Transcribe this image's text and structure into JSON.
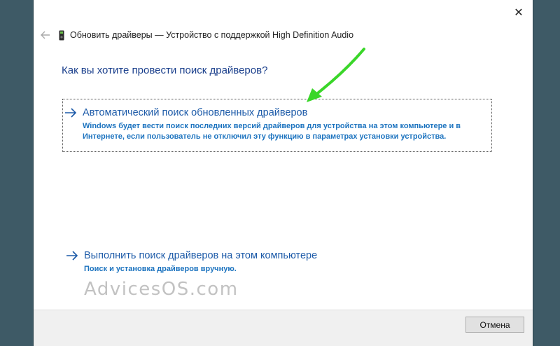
{
  "window": {
    "title": "Обновить драйверы — Устройство с поддержкой High Definition Audio"
  },
  "question": "Как вы хотите провести поиск драйверов?",
  "options": [
    {
      "title": "Автоматический поиск обновленных драйверов",
      "description_line1": "Windows будет вести поиск последних версий драйверов для устройства на этом компьютере и в",
      "description_line2": "Интернете, если пользователь не отключил эту функцию в параметрах установки устройства."
    },
    {
      "title": "Выполнить поиск драйверов на этом компьютере",
      "description_line1": "Поиск и установка драйверов вручную."
    }
  ],
  "watermark": "AdvicesOS.com",
  "footer": {
    "cancel_label": "Отмена"
  },
  "colors": {
    "accent_link": "#1c5aa8",
    "heading": "#1a3f8c",
    "annotation_arrow": "#3ad629",
    "backdrop": "#3e5a66"
  },
  "icons": {
    "back": "back-arrow-icon",
    "device": "audio-device-icon",
    "close": "close-icon",
    "option_arrow": "right-arrow-icon"
  }
}
